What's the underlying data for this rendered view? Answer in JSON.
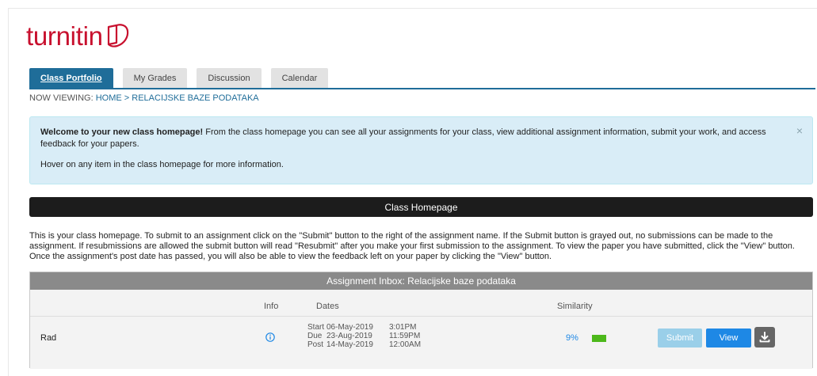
{
  "brand": {
    "logo_text": "turnitin",
    "color": "#c8102e"
  },
  "tabs": [
    {
      "label": "Class Portfolio",
      "active": true
    },
    {
      "label": "My Grades",
      "active": false
    },
    {
      "label": "Discussion",
      "active": false
    },
    {
      "label": "Calendar",
      "active": false
    }
  ],
  "breadcrumb": {
    "prefix": "NOW VIEWING: ",
    "home": "HOME",
    "separator": " > ",
    "current": "RELACIJSKE BAZE PODATAKA"
  },
  "welcome": {
    "bold": "Welcome to your new class homepage!",
    "text": " From the class homepage you can see all your assignments for your class, view additional assignment information, submit your work, and access feedback for your papers.",
    "hover": "Hover on any item in the class homepage for more information.",
    "close": "×"
  },
  "class_homepage": {
    "title": "Class Homepage"
  },
  "intro": "This is your class homepage. To submit to an assignment click on the \"Submit\" button to the right of the assignment name. If the Submit button is grayed out, no submissions can be made to the assignment. If resubmissions are allowed the submit button will read \"Resubmit\" after you make your first submission to the assignment. To view the paper you have submitted, click the \"View\" button. Once the assignment's post date has passed, you will also be able to view the feedback left on your paper by clicking the \"View\" button.",
  "inbox": {
    "title": "Assignment Inbox: Relacijske baze podataka",
    "headers": {
      "info": "Info",
      "dates": "Dates",
      "similarity": "Similarity"
    },
    "row": {
      "name": "Rad",
      "start_label": "Start",
      "start_date": "06-May-2019",
      "start_time": "3:01PM",
      "due_label": "Due",
      "due_date": "23-Aug-2019",
      "due_time": "11:59PM",
      "post_label": "Post",
      "post_date": "14-May-2019",
      "post_time": "12:00AM",
      "similarity": "9%",
      "similarity_color": "#4cb81a",
      "submit_label": "Submit",
      "view_label": "View"
    }
  }
}
